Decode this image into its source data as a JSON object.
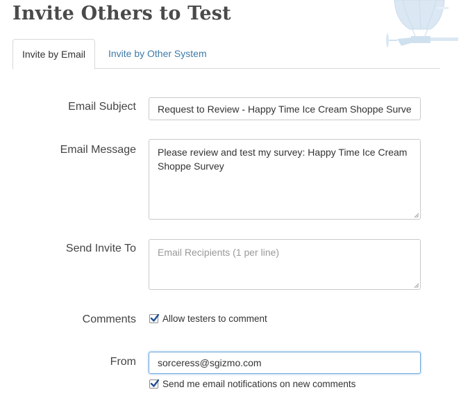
{
  "page": {
    "title": "Invite Others to Test"
  },
  "tabs": [
    {
      "label": "Invite by Email",
      "active": true
    },
    {
      "label": "Invite by Other System",
      "active": false
    }
  ],
  "form": {
    "subject": {
      "label": "Email Subject",
      "value": "Request to Review - Happy Time Ice Cream Shoppe Survey"
    },
    "message": {
      "label": "Email Message",
      "value": "Please review and test my survey: Happy Time Ice Cream Shoppe Survey"
    },
    "recipients": {
      "label": "Send Invite To",
      "value": "",
      "placeholder": "Email Recipients (1 per line)"
    },
    "comments": {
      "label": "Comments",
      "checkbox_label": "Allow testers to comment",
      "checked": true
    },
    "from": {
      "label": "From",
      "value": "sorceress@sgizmo.com",
      "notify_label": "Send me email notifications on new comments",
      "notify_checked": true
    }
  },
  "colors": {
    "tab_link": "#3d7aa8",
    "check": "#1f4f8f",
    "focus": "#6fa8dc",
    "balloon": "#d6e6f2"
  },
  "icons": {
    "balloon": "hot-air-balloon-icon",
    "check": "checkmark-icon"
  }
}
